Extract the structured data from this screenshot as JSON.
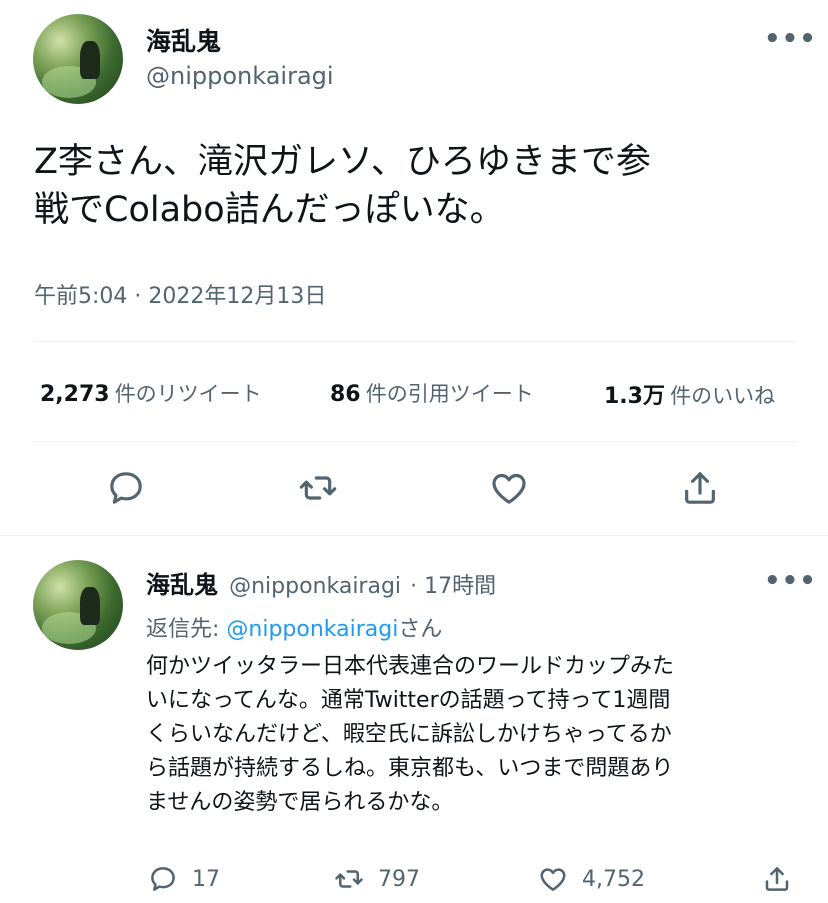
{
  "main_tweet": {
    "author_name": "海乱鬼",
    "author_handle": "@nipponkairagi",
    "more_label": "•••",
    "text_line1": "Z李さん、滝沢ガレソ、ひろゆきまで参",
    "text_line2": "戦でColabo詰んだっぽいな。",
    "timestamp": "午前5:04 · 2022年12月13日",
    "stats": {
      "retweets_count": "2,273",
      "retweets_label": "件のリツイート",
      "quotes_count": "86",
      "quotes_label": "件の引用ツイート",
      "likes_count": "1.3万",
      "likes_label": "件のいいね"
    },
    "actions": [
      "reply-icon",
      "retweet-icon",
      "like-icon",
      "share-icon"
    ]
  },
  "reply_tweet": {
    "author_name": "海乱鬼",
    "author_handle": "@nipponkairagi",
    "time_ago": "· 17時間",
    "more_label": "•••",
    "reply_to_prefix": "返信先: ",
    "reply_to_handle": "@nipponkairagi",
    "reply_to_suffix": "さん",
    "text_lines": [
      "何かツイッタラー日本代表連合のワールドカップみた",
      "いになってんな。通常Twitterの話題って持って1週間",
      "くらいなんだけど、暇空氏に訴訟しかけちゃってるか",
      "ら話題が持続するしね。東京都も、いつまで問題あり",
      "ませんの姿勢で居られるかな。"
    ],
    "reply_count": "17",
    "retweet_count": "797",
    "like_count": "4,752"
  },
  "colors": {
    "text_primary": "#0f1419",
    "text_secondary": "#536471",
    "link": "#1d9bf0",
    "divider": "#eff3f4"
  }
}
